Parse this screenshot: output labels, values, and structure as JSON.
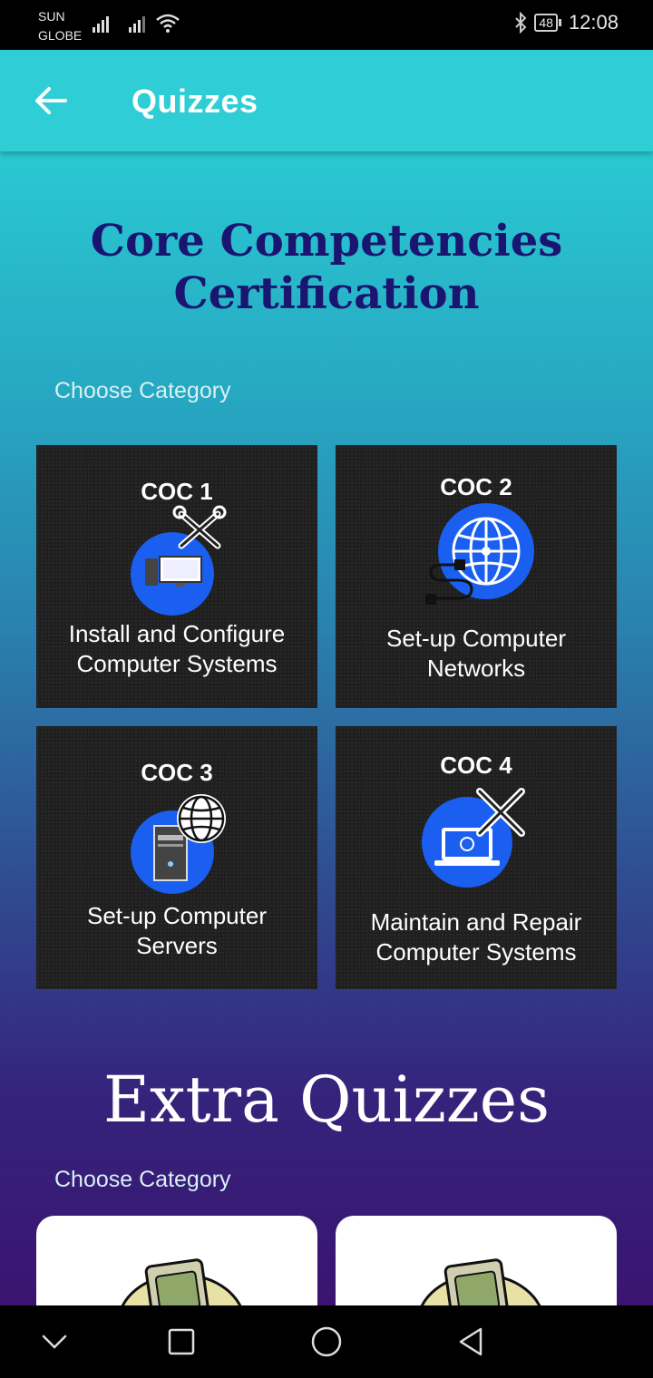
{
  "status_bar": {
    "carrier_1": "SUN",
    "carrier_2": "GLOBE",
    "battery": "48",
    "time": "12:08"
  },
  "app_bar": {
    "title": "Quizzes"
  },
  "core": {
    "title_line1": "Core Competencies",
    "title_line2": "Certification",
    "choose": "Choose Category",
    "cards": [
      {
        "code": "COC 1",
        "label": "Install and Configure\nComputer Systems",
        "icon": "monitor-tools-icon"
      },
      {
        "code": "COC 2",
        "label": "Set-up Computer\nNetworks",
        "icon": "globe-cable-icon"
      },
      {
        "code": "COC 3",
        "label": "Set-up Computer\nServers",
        "icon": "server-globe-icon"
      },
      {
        "code": "COC 4",
        "label": "Maintain and Repair\nComputer Systems",
        "icon": "laptop-tools-icon"
      }
    ]
  },
  "extra": {
    "title": "Extra Quizzes",
    "choose": "Choose Category",
    "cards": [
      {
        "icon": "computer-cartoon-icon"
      },
      {
        "icon": "computer-cartoon-icon"
      }
    ]
  },
  "colors": {
    "app_bar": "#2fcdd6",
    "core_title": "#1a1570",
    "icon_circle": "#1a5ff0",
    "card_bg": "#1f1f1f"
  }
}
